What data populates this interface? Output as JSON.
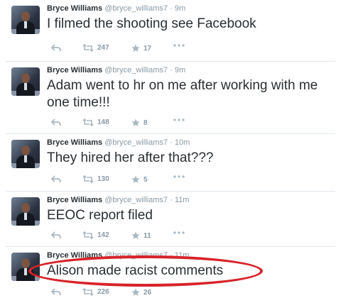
{
  "tweets": [
    {
      "name": "Bryce Williams",
      "handle": "@bryce_williams7",
      "time": "9m",
      "text": "I filmed the shooting see Facebook",
      "retweets": "247",
      "favorites": "17"
    },
    {
      "name": "Bryce Williams",
      "handle": "@bryce_williams7",
      "time": "9m",
      "text": "Adam went to hr on me after working with me one time!!!",
      "retweets": "148",
      "favorites": "8"
    },
    {
      "name": "Bryce Williams",
      "handle": "@bryce_williams7",
      "time": "10m",
      "text": "They hired her after that???",
      "retweets": "130",
      "favorites": "5"
    },
    {
      "name": "Bryce Williams",
      "handle": "@bryce_williams7",
      "time": "11m",
      "text": "EEOC report filed",
      "retweets": "142",
      "favorites": "11"
    },
    {
      "name": "Bryce Williams",
      "handle": "@bryce_williams7",
      "time": "11m",
      "text": "Alison made racist comments",
      "retweets": "226",
      "favorites": "26"
    }
  ],
  "separator": "·",
  "icons": {
    "avatar": "profile-photo",
    "reply": "reply-icon",
    "retweet": "retweet-icon",
    "favorite": "star-icon",
    "more": "more-icon"
  },
  "colors": {
    "name": "#292f33",
    "meta": "#8899a6",
    "annotation": "#d8232a"
  }
}
